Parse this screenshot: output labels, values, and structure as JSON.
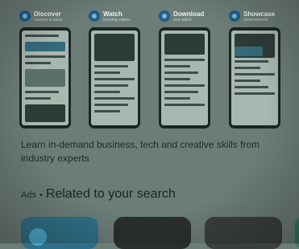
{
  "carousel": {
    "cards": [
      {
        "title": "Discover",
        "subtitle": "courses & paths"
      },
      {
        "title": "Watch",
        "subtitle": "learning videos"
      },
      {
        "title": "Download",
        "subtitle": "and watch"
      },
      {
        "title": "Showcase",
        "subtitle": "achievements"
      }
    ]
  },
  "description": "Learn in-demand business, tech and creative skills from industry experts",
  "ads": {
    "label": "Ads",
    "separator": "•",
    "title": "Related to your search"
  },
  "colors": {
    "background": "#6c7c77",
    "app_icon": "#1c5e88",
    "phone_frame": "#1b2624"
  }
}
